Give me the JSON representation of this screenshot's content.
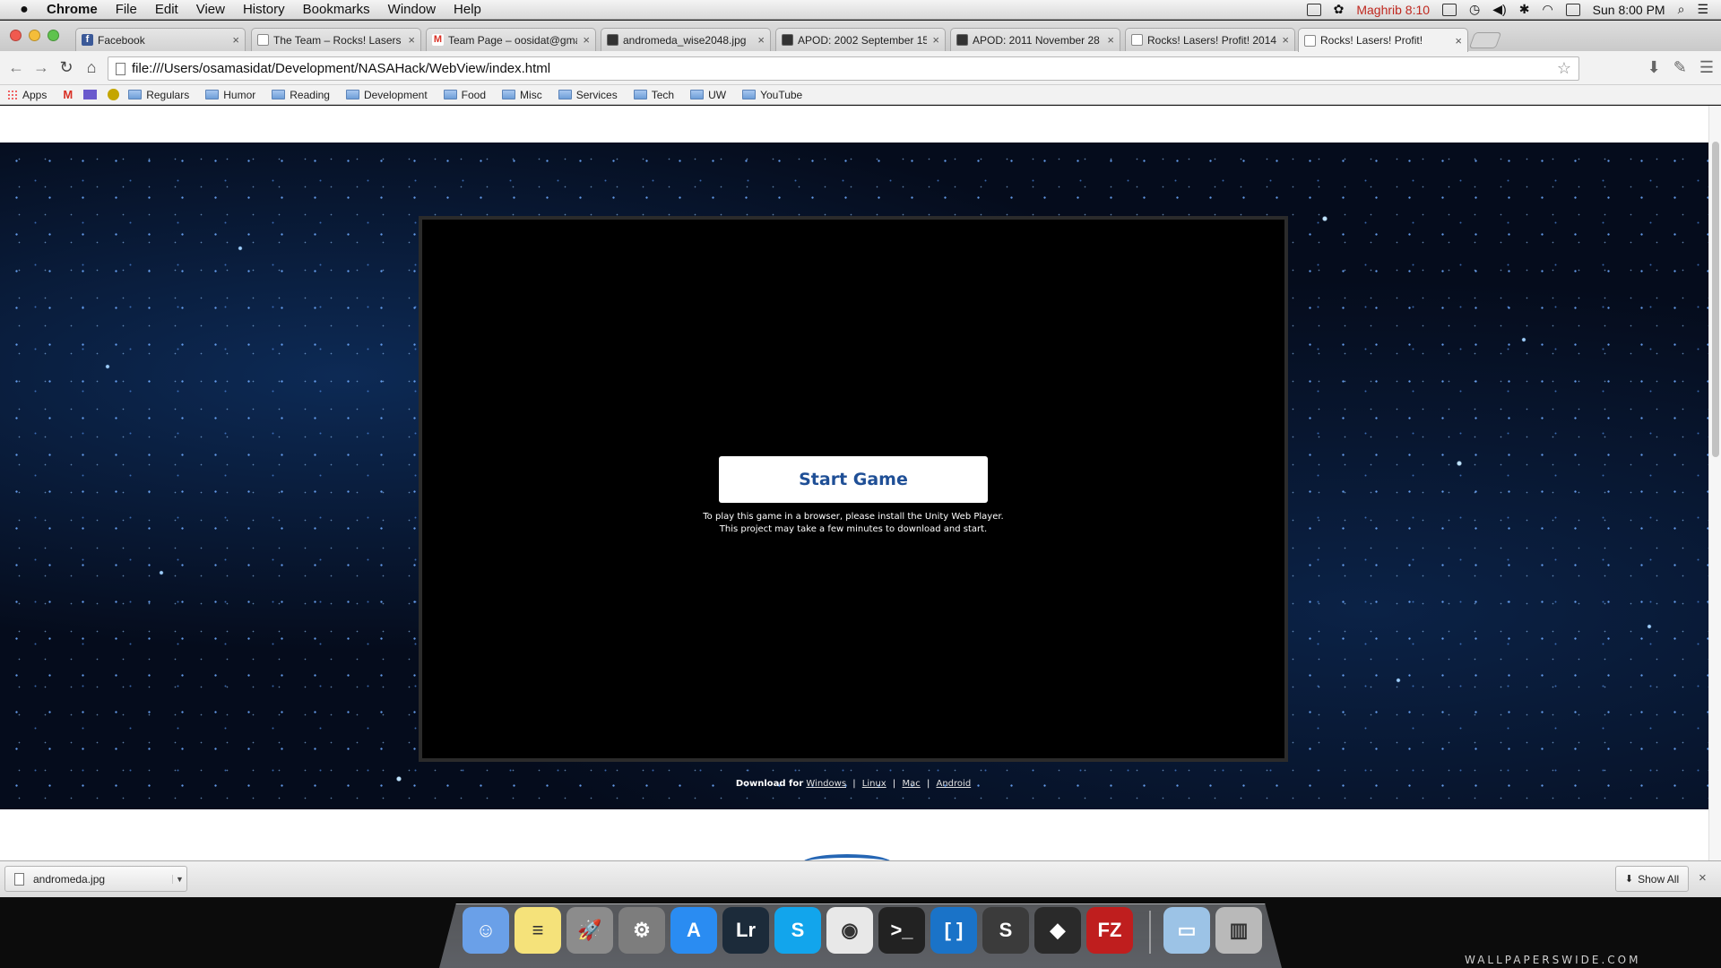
{
  "menubar": {
    "app_name": "Chrome",
    "items": [
      "File",
      "Edit",
      "View",
      "History",
      "Bookmarks",
      "Window",
      "Help"
    ],
    "prayer_time": "Maghrib 8:10",
    "clock": "Sun 8:00 PM"
  },
  "tabs": [
    {
      "title": "Facebook",
      "icon": "facebook-icon"
    },
    {
      "title": "The Team – Rocks! Lasers",
      "icon": "page-icon"
    },
    {
      "title": "Team Page – oosidat@gma",
      "icon": "gmail-icon"
    },
    {
      "title": "andromeda_wise2048.jpg",
      "icon": "image-icon"
    },
    {
      "title": "APOD: 2002 September 15",
      "icon": "image-icon"
    },
    {
      "title": "APOD: 2011 November 28",
      "icon": "image-icon"
    },
    {
      "title": "Rocks! Lasers! Profit! 2014",
      "icon": "page-icon"
    },
    {
      "title": "Rocks! Lasers! Profit!",
      "icon": "page-icon"
    }
  ],
  "address_bar": {
    "url": "file:///Users/osamasidat/Development/NASAHack/WebView/index.html"
  },
  "bookmarks": {
    "apps_label": "Apps",
    "folders": [
      "Regulars",
      "Humor",
      "Reading",
      "Development",
      "Food",
      "Misc",
      "Services",
      "Tech",
      "UW",
      "YouTube"
    ]
  },
  "game": {
    "start_button": "Start Game",
    "install_line1": "To play this game in a browser, please install the Unity Web Player.",
    "install_line2": "This project may take a few minutes to download and start."
  },
  "downloads_links": {
    "label": "Download for",
    "windows": "Windows",
    "linux": "Linux",
    "mac": "Mac",
    "android": "Android",
    "separator": "|"
  },
  "download_shelf": {
    "file_name": "andromeda.jpg",
    "show_all": "Show All"
  },
  "dock": {
    "apps": [
      {
        "name": "finder",
        "color": "#6aa0e8",
        "glyph": "☺"
      },
      {
        "name": "stickies",
        "color": "#f5e27a",
        "glyph": "≡"
      },
      {
        "name": "launchpad",
        "color": "#8c8c8c",
        "glyph": "🚀"
      },
      {
        "name": "system-preferences",
        "color": "#7d7d7d",
        "glyph": "⚙"
      },
      {
        "name": "app-store",
        "color": "#2a8cf2",
        "glyph": "A"
      },
      {
        "name": "lightroom",
        "color": "#1c2b3a",
        "glyph": "Lr"
      },
      {
        "name": "skype",
        "color": "#12a5ec",
        "glyph": "S"
      },
      {
        "name": "chrome",
        "color": "#e8e8e8",
        "glyph": "◉"
      },
      {
        "name": "terminal",
        "color": "#222222",
        "glyph": ">_"
      },
      {
        "name": "brackets",
        "color": "#1a73c8",
        "glyph": "[ ]"
      },
      {
        "name": "sublime-text",
        "color": "#3b3b3b",
        "glyph": "S"
      },
      {
        "name": "unity",
        "color": "#2a2a2a",
        "glyph": "◆"
      },
      {
        "name": "filezilla",
        "color": "#bf1e1e",
        "glyph": "FZ"
      },
      {
        "name": "documents-folder",
        "color": "#9cc3e6",
        "glyph": "▭"
      },
      {
        "name": "trash",
        "color": "#b9b9b9",
        "glyph": "▥"
      }
    ]
  },
  "watermark": "WALLPAPERSWIDE.COM"
}
